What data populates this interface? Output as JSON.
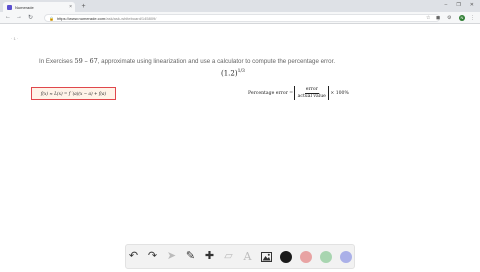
{
  "browser": {
    "tab_title": "Numerade",
    "tab_close": "×",
    "new_tab": "+",
    "window_buttons": [
      "–",
      "❐",
      "✕"
    ],
    "back": "←",
    "forward": "→",
    "reload": "↻",
    "url_host": "https://www.numerade.com",
    "url_path": "/ask/ask-whiteboard/145809/",
    "star": "☆",
    "profile_initial": "N"
  },
  "page": {
    "pager": "· 1 ·",
    "question_prefix": "In Exercises",
    "question_start": "59",
    "question_dash": "–",
    "question_end": "67",
    "question_suffix": ", approximate using linearization and use a calculator to compute the percentage error.",
    "expression_base": "(1.2)",
    "expression_exp": "1/3",
    "linearization": "f(x) ≈ L(x) = f ′(a)(x − a) + f(a)",
    "pct_label": "Percentage error =",
    "pct_num": "error",
    "pct_den": "actual value",
    "pct_suffix": "× 100%"
  },
  "drawing_toolbar": {
    "undo": "↶",
    "redo": "↷",
    "select": "➤",
    "pen": "✎",
    "add": "✚",
    "eraser": "▱",
    "text": "A",
    "image": "🖼",
    "colors": [
      "#1a1a1a",
      "#e8a3a3",
      "#a8d5b0",
      "#aab0e8"
    ]
  }
}
